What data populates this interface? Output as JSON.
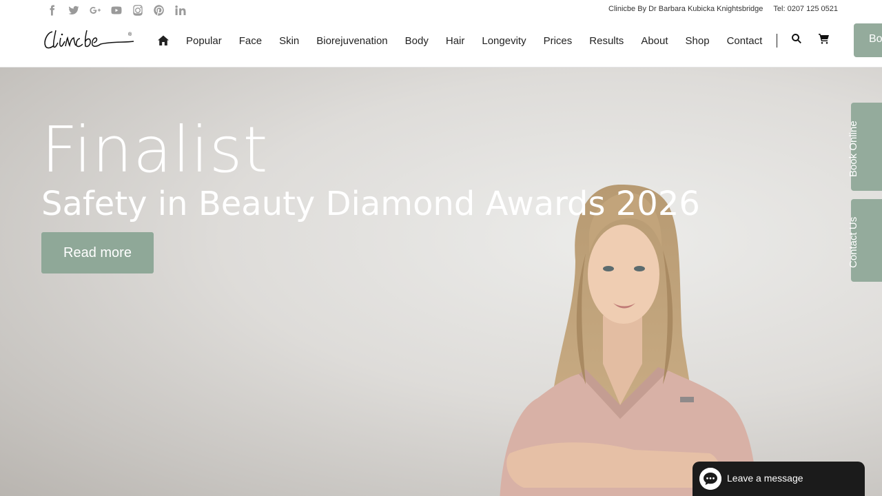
{
  "topbar": {
    "social_icons": [
      "facebook-icon",
      "twitter-icon",
      "google-plus-icon",
      "youtube-icon",
      "instagram-icon",
      "pinterest-icon",
      "linkedin-icon"
    ],
    "clinic_name": "Clinicbe By Dr Barbara Kubicka Knightsbridge",
    "phone": "Tel: 0207 125 0521"
  },
  "header": {
    "logo_text": "Clinicbe",
    "nav": [
      "Popular",
      "Face",
      "Skin",
      "Biorejuvenation",
      "Body",
      "Hair",
      "Longevity",
      "Prices",
      "Results",
      "About",
      "Shop",
      "Contact"
    ],
    "book_label": "Book"
  },
  "hero": {
    "title": "Finalist",
    "subtitle": "Safety in Beauty Diamond Awards 2026",
    "cta": "Read more"
  },
  "side_tabs": {
    "book_online": "Book Online",
    "contact_us": "Contact Us"
  },
  "chat": {
    "label": "Leave a message"
  },
  "colors": {
    "accent": "#94ab9c",
    "chat_bg": "#1b1b1b"
  }
}
